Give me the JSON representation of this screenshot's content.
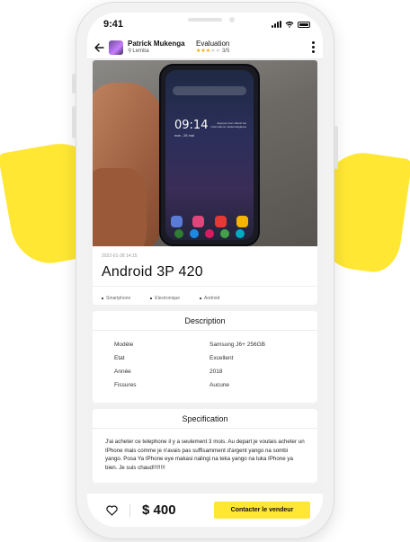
{
  "status_bar": {
    "time": "9:41"
  },
  "header": {
    "user_name": "Patrick Mukenga",
    "location": "Lemba",
    "evaluation_label": "Evaluation",
    "rating": 3,
    "rating_max": 5,
    "rating_text": "3/5"
  },
  "product": {
    "date": "2022-01-28 14:15",
    "title": "Android 3P 420",
    "tags": [
      "Smartphone",
      "Electronique",
      "Android"
    ],
    "photo_screen": {
      "time": "09:14",
      "date_line": "mar., 28 mai",
      "weather_note": "Appuyer pour obtenir les informations météorologiques"
    }
  },
  "description": {
    "title": "Description",
    "rows": [
      {
        "key": "Modèle",
        "value": "Samsung J6+ 256GB"
      },
      {
        "key": "Etat",
        "value": "Excellent"
      },
      {
        "key": "Année",
        "value": "2018"
      },
      {
        "key": "Fissures",
        "value": "Aucune"
      }
    ]
  },
  "specification": {
    "title": "Specification",
    "text": "J'ai acheter ce telephone il y a seulement 3 mois. Au depart je voulais acheter un IPhone mais comme je n'avais pas suffisamment d'argent yango na sombi yango. Posa Ya IPhone eye makasi nalingi na teka yango na luka IPhone ya bien. Je suis chaud!!!!!!!!"
  },
  "bottom_bar": {
    "price": "$ 400",
    "cta_label": "Contacter le vendeur"
  },
  "colors": {
    "accent": "#ffe733",
    "star": "#f0a500"
  }
}
